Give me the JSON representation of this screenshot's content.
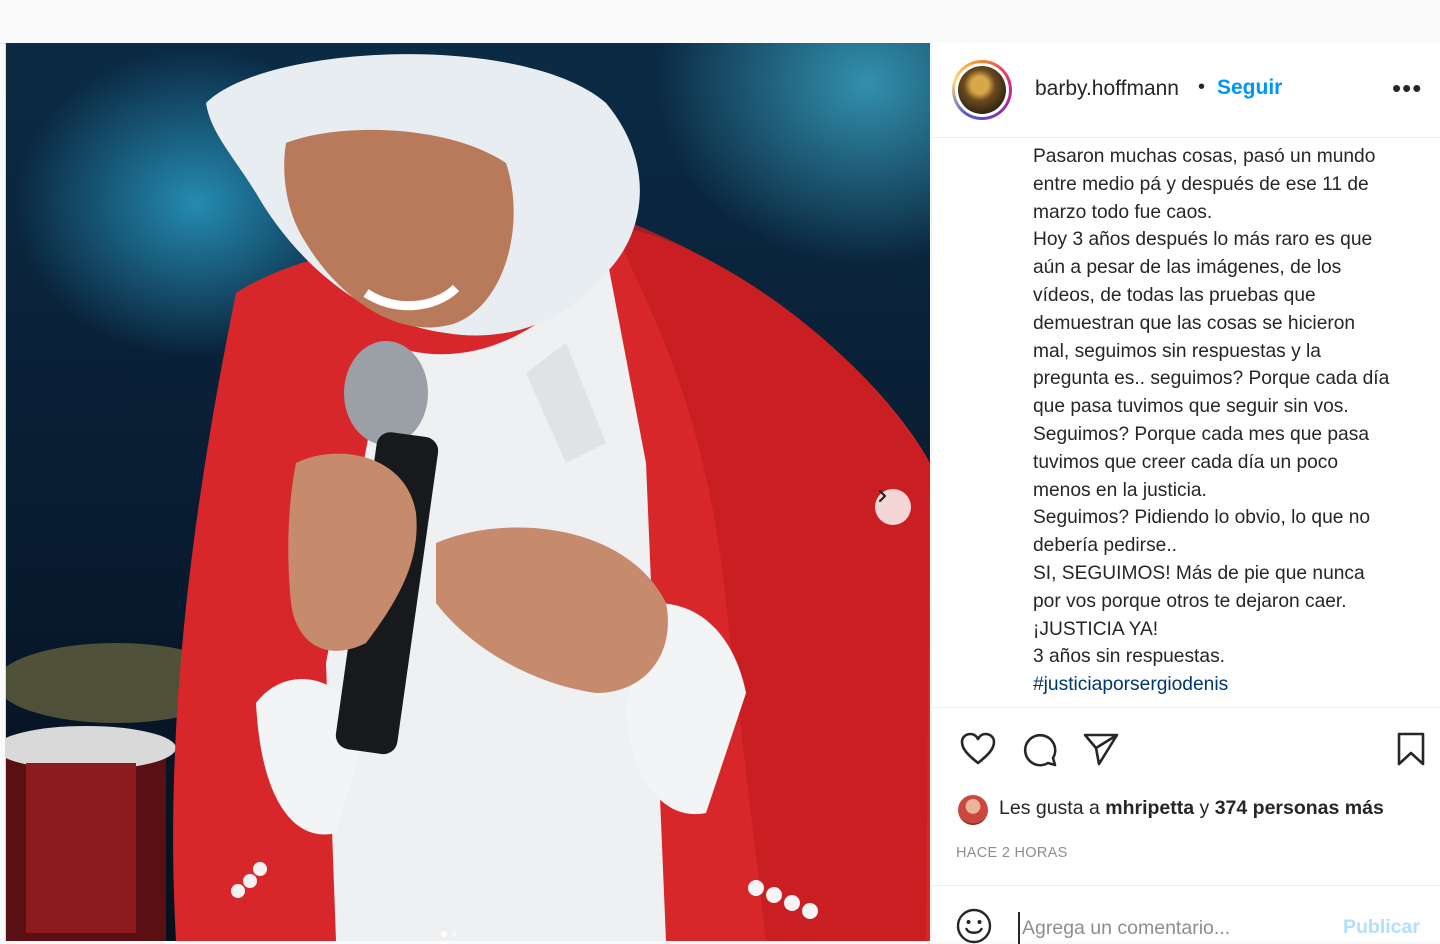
{
  "post": {
    "username": "barby.hoffmann",
    "separator": "•",
    "follow_label": "Seguir",
    "more_label": "•••",
    "caption_lines": [
      "Pasaron muchas cosas, pasó un mundo",
      "entre medio pá y después de ese 11 de",
      "marzo todo fue caos.",
      "Hoy 3 años después lo más raro es que",
      "aún a pesar de las imágenes, de los",
      "vídeos, de todas las pruebas que",
      "demuestran que las cosas se hicieron",
      "mal, seguimos sin respuestas y la",
      "pregunta es.. seguimos? Porque cada día",
      "que pasa tuvimos que seguir sin vos.",
      "Seguimos? Porque cada mes que pasa",
      "tuvimos que creer cada día un poco",
      "menos en la justicia.",
      "Seguimos? Pidiendo lo obvio, lo que no",
      "debería pedirse..",
      "SI, SEGUIMOS! Más de pie que nunca",
      "por vos porque otros te dejaron caer.",
      "¡JUSTICIA YA!",
      "3 años sin respuestas."
    ],
    "hashtag": "#justiciaporsergiodenis",
    "likes": {
      "prefix": "Les gusta a",
      "user": "mhripetta",
      "joiner": "y",
      "others": "374 personas más"
    },
    "time_ago": "HACE 2 HORAS",
    "comment_placeholder": "Agrega un comentario...",
    "publish_label": "Publicar",
    "carousel": {
      "total": 2,
      "current": 1
    }
  },
  "icons": {
    "like": "heart-icon",
    "comment": "comment-icon",
    "share": "paper-plane-icon",
    "save": "bookmark-icon",
    "emoji": "smiley-icon",
    "next": "chevron-right-icon"
  },
  "colors": {
    "link_blue": "#0095f6",
    "hashtag": "#00376b",
    "publish_disabled": "#b2dffc",
    "muted": "#8e8e8e"
  }
}
